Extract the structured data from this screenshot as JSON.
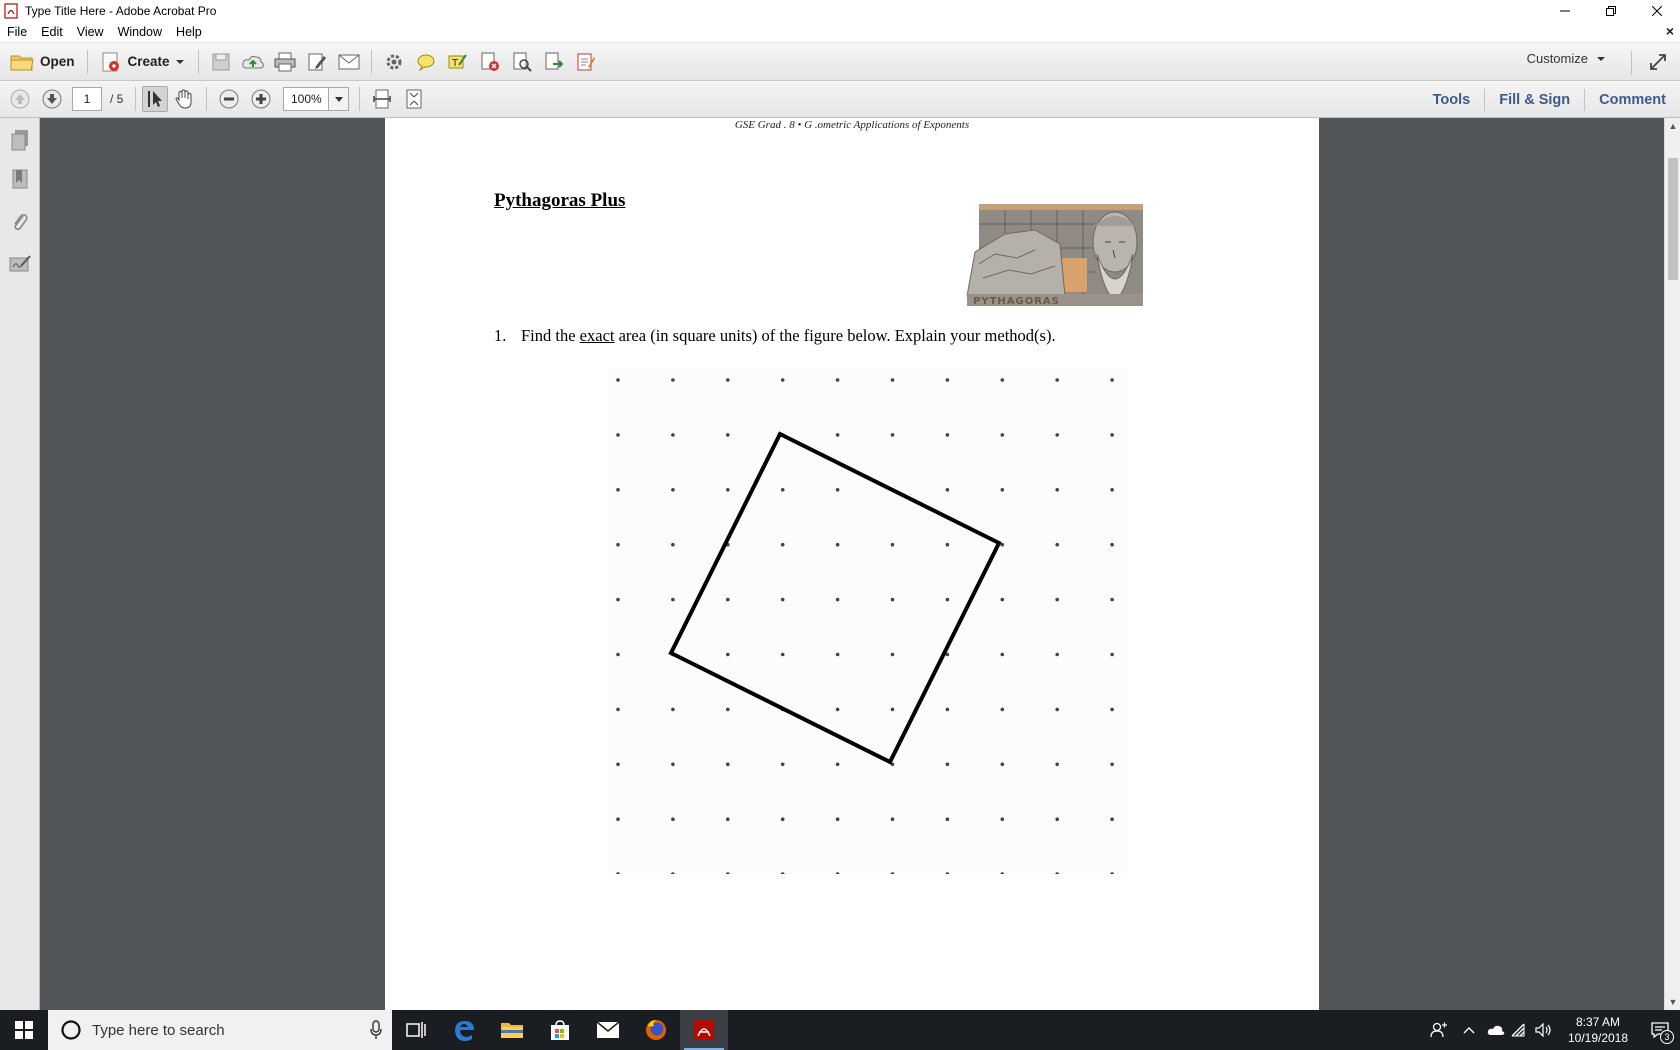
{
  "window": {
    "title": "Type Title Here - Adobe Acrobat Pro",
    "minimize_icon": "minimize-icon",
    "restore_icon": "restore-icon",
    "close_icon": "close-icon"
  },
  "menu": {
    "items": [
      "File",
      "Edit",
      "View",
      "Window",
      "Help"
    ],
    "doc_close": "×"
  },
  "toolbar": {
    "open_label": "Open",
    "create_label": "Create",
    "customize_label": "Customize"
  },
  "nav": {
    "current_page": "1",
    "total_pages": "/ 5",
    "zoom": "100%"
  },
  "panes": {
    "tools": "Tools",
    "fill_sign": "Fill & Sign",
    "comment": "Comment"
  },
  "document": {
    "running_head": "GSE Grad . 8 • G .ometric Applications of Exponents",
    "title": "Pythagoras Plus",
    "image_caption": "PYTHAGORAS",
    "question_number": "1.",
    "question_pre": "Find the ",
    "question_emph": "exact",
    "question_post": " area (in square units) of the figure below.  Explain your method(s)."
  },
  "taskbar": {
    "search_placeholder": "Type here to search",
    "time": "8:37 AM",
    "date": "10/19/2018",
    "notification_count": "3"
  },
  "colors": {
    "accent_pane": "#3d5a8a",
    "viewport_bg": "#525659",
    "taskbar_bg": "#1a1d22"
  }
}
